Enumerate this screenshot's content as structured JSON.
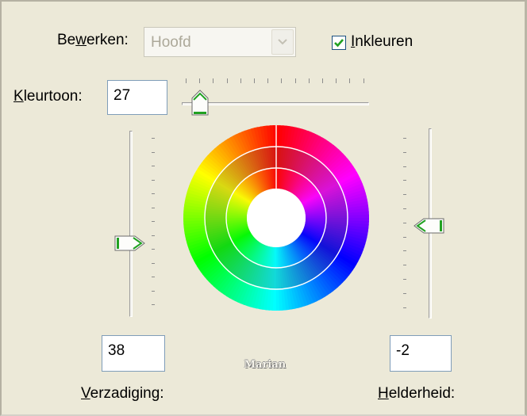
{
  "edit": {
    "label_pre": "Be",
    "label_access": "w",
    "label_post": "erken:",
    "combo_value": "Hoofd"
  },
  "colorize": {
    "checked": true,
    "label_access": "I",
    "label_post": "nkleuren"
  },
  "hue": {
    "label_access": "K",
    "label_post": "leurtoon:",
    "value": "27"
  },
  "saturation": {
    "label_access": "V",
    "label_post": "erzadiging:",
    "value": "38"
  },
  "lightness": {
    "label_access": "H",
    "label_post": "elderheid:",
    "value": "-2"
  },
  "watermark": "Marian",
  "icons": {
    "combo_arrow": "chevron-down-icon",
    "check": "checkmark-icon"
  },
  "colors": {
    "background": "#ece9d8",
    "slider_thumb_fill": "#ffffff",
    "slider_thumb_accent": "#21a121",
    "checkmark": "#21a121"
  }
}
